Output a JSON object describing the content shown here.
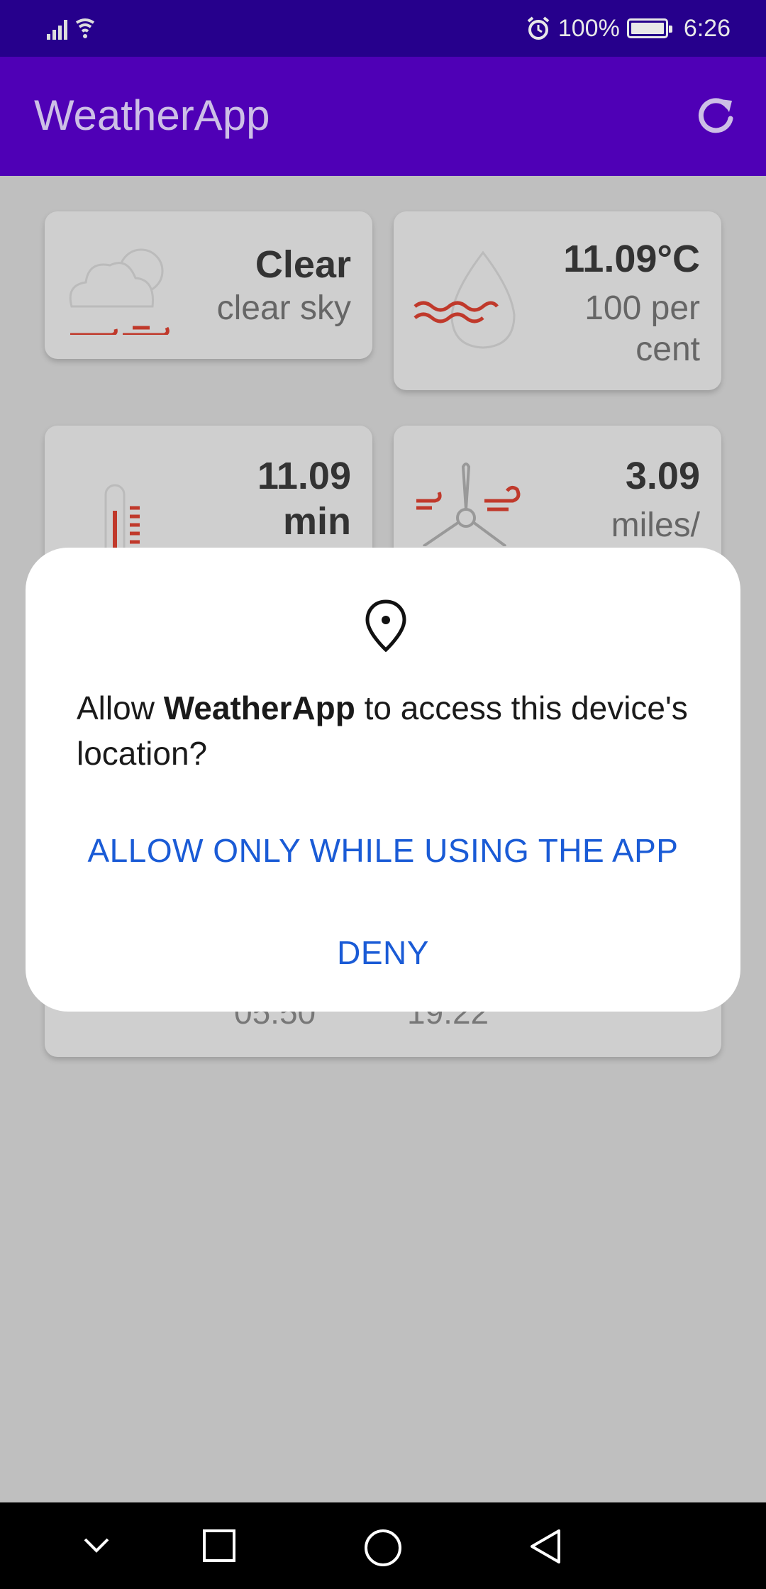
{
  "status_bar": {
    "battery_text": "100%",
    "time": "6:26",
    "icons": [
      "signal-icon",
      "wifi-icon",
      "alarm-icon",
      "battery-icon"
    ]
  },
  "app_bar": {
    "title": "WeatherApp",
    "refresh_icon": "refresh-icon"
  },
  "cards": {
    "condition": {
      "title": "Clear",
      "subtitle": "clear sky",
      "icon": "cloud-wind-icon"
    },
    "humidity": {
      "title": "11.09°C",
      "subtitle_line1": "100 per",
      "subtitle_line2": "cent",
      "icon": "humidity-drop-icon"
    },
    "temperature": {
      "title_line1": "11.09",
      "title_line2": "min",
      "icon": "thermometer-icon"
    },
    "wind": {
      "title": "3.09",
      "subtitle": "miles/",
      "icon": "wind-turbine-icon"
    },
    "sun": {
      "sunrise": "05:50",
      "sunset": "19:22"
    }
  },
  "dialog": {
    "icon": "location-pin-icon",
    "message_prefix": "Allow ",
    "app_name": "WeatherApp",
    "message_suffix": " to access this device's location?",
    "allow_label": "ALLOW ONLY WHILE USING THE APP",
    "deny_label": "DENY"
  },
  "nav_bar": {
    "icons": [
      "chevron-down-icon",
      "recents-square-icon",
      "home-circle-icon",
      "back-triangle-icon"
    ]
  },
  "colors": {
    "status_bar": "#26008c",
    "app_bar": "#4f00b6",
    "dialog_button": "#1a5bd6",
    "icon_accent": "#c0392b"
  }
}
